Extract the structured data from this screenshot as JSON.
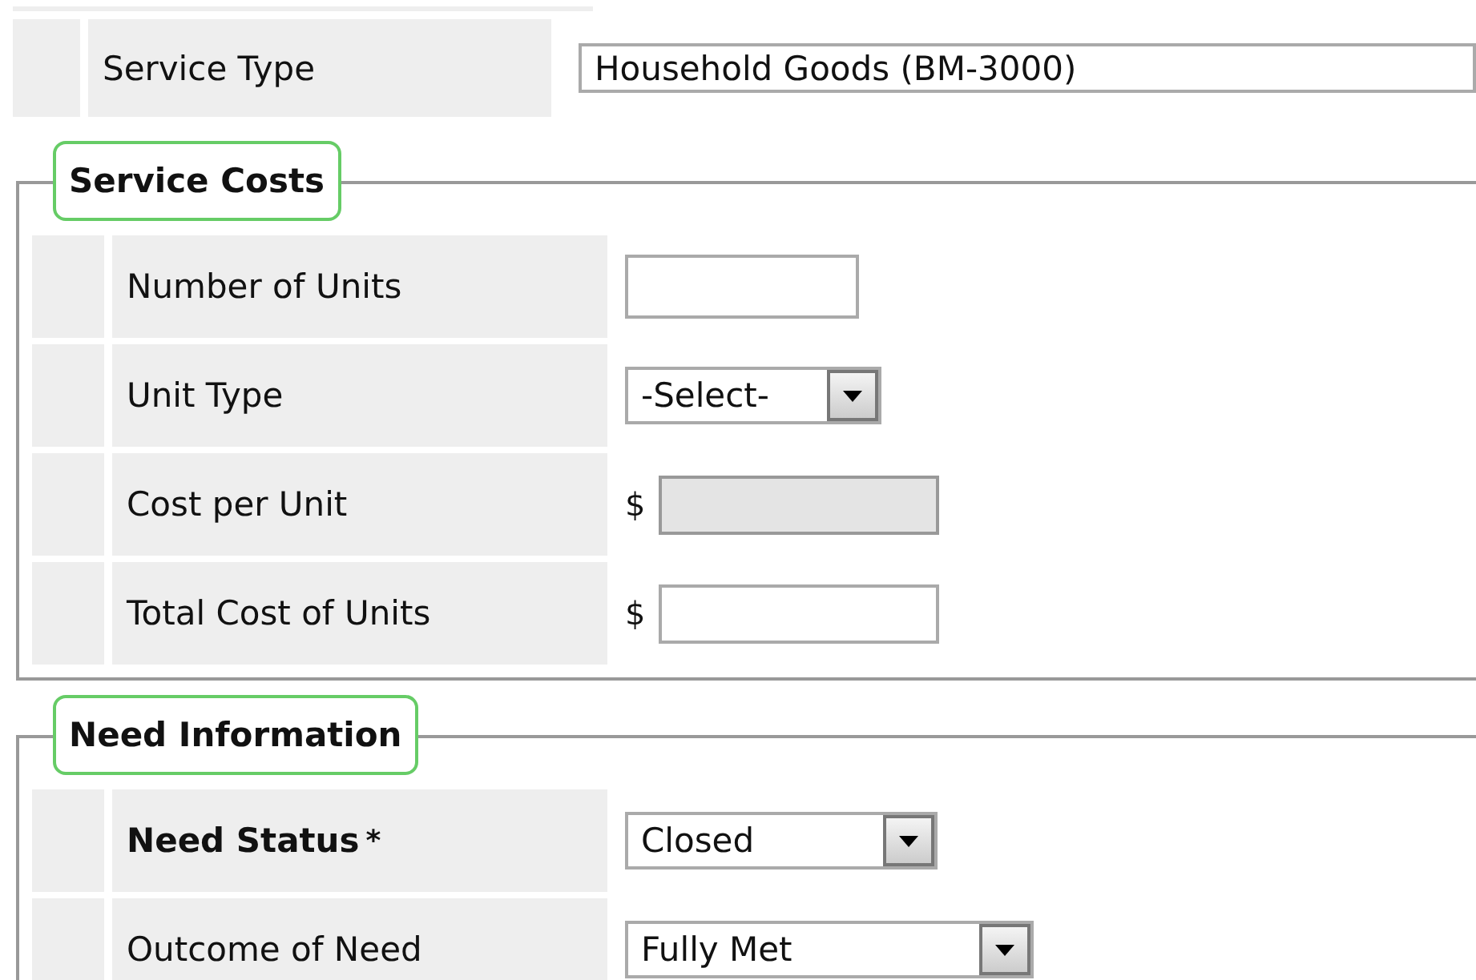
{
  "service_type": {
    "label": "Service Type",
    "value": "Household Goods (BM-3000)"
  },
  "sections": [
    {
      "title": "Service Costs",
      "fields": [
        {
          "label": "Number of Units",
          "kind": "text",
          "disabled": false
        },
        {
          "label": "Unit Type",
          "kind": "select",
          "value": "-Select-",
          "disabled": false
        },
        {
          "label": "Cost per Unit",
          "kind": "text",
          "prefix": "$",
          "disabled": true
        },
        {
          "label": "Total Cost of Units",
          "kind": "text",
          "prefix": "$",
          "disabled": false
        }
      ]
    },
    {
      "title": "Need Information",
      "fields": [
        {
          "label": "Need Status",
          "required_mark": "*",
          "kind": "select",
          "value": "Closed",
          "disabled": false
        },
        {
          "label": "Outcome of Need",
          "kind": "select",
          "value": "Fully Met",
          "disabled": false
        }
      ]
    }
  ]
}
